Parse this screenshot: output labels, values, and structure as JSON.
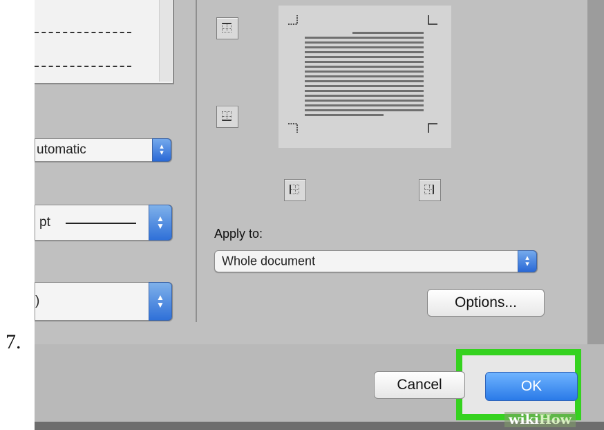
{
  "step": {
    "number": "7."
  },
  "left_column": {
    "color_popup": {
      "value": "utomatic"
    },
    "width_popup": {
      "value": "pt"
    },
    "art_popup": {
      "value": ")"
    }
  },
  "preview": {
    "border_buttons": [
      "top-border",
      "bottom-border",
      "left-border",
      "right-border"
    ]
  },
  "apply": {
    "label": "Apply to:",
    "value": "Whole document"
  },
  "buttons": {
    "options": "Options...",
    "cancel": "Cancel",
    "ok": "OK"
  },
  "watermark": {
    "wiki": "wiki",
    "how": "How"
  },
  "colors": {
    "highlight": "#35d21f",
    "ok_blue": "#2a7ae8",
    "panel_gray": "#c0c0c0"
  }
}
